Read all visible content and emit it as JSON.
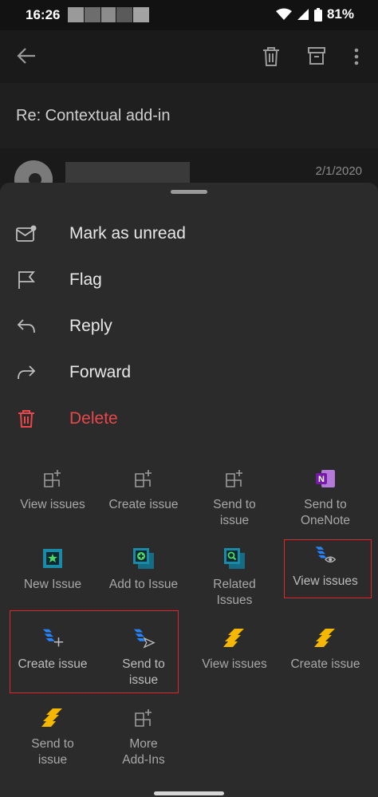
{
  "status": {
    "time": "16:26",
    "battery": "81%"
  },
  "email": {
    "subject": "Re: Contextual add-in",
    "date": "2/1/2020"
  },
  "menu": [
    {
      "label": "Mark as unread",
      "icon": "mail-unread-icon"
    },
    {
      "label": "Flag",
      "icon": "flag-icon"
    },
    {
      "label": "Reply",
      "icon": "reply-icon"
    },
    {
      "label": "Forward",
      "icon": "forward-icon"
    },
    {
      "label": "Delete",
      "icon": "trash-icon"
    }
  ],
  "addins": [
    {
      "label": "View issues",
      "icon": "addin-grid-icon"
    },
    {
      "label": "Create issue",
      "icon": "addin-grid-icon"
    },
    {
      "label": "Send to issue",
      "icon": "addin-grid-icon"
    },
    {
      "label": "Send to OneNote",
      "icon": "onenote-icon"
    },
    {
      "label": "New Issue",
      "icon": "new-issue-icon"
    },
    {
      "label": "Add to Issue",
      "icon": "add-to-issue-icon"
    },
    {
      "label": "Related Issues",
      "icon": "related-issues-icon"
    },
    {
      "label": "View issues",
      "icon": "jira-view-icon"
    },
    {
      "label": "Create issue",
      "icon": "jira-create-icon"
    },
    {
      "label": "Send to issue",
      "icon": "jira-send-icon"
    },
    {
      "label": "View issues",
      "icon": "jira-yellow-icon"
    },
    {
      "label": "Create issue",
      "icon": "jira-yellow-icon"
    },
    {
      "label": "Send to issue",
      "icon": "jira-yellow-icon"
    },
    {
      "label": "More Add-Ins",
      "icon": "addin-grid-icon"
    }
  ],
  "colors": {
    "delete": "#e8474b",
    "highlight": "#e0262b",
    "jira_blue": "#2684ff",
    "jira_yellow": "#f5b700",
    "onenote": "#7719aa"
  }
}
